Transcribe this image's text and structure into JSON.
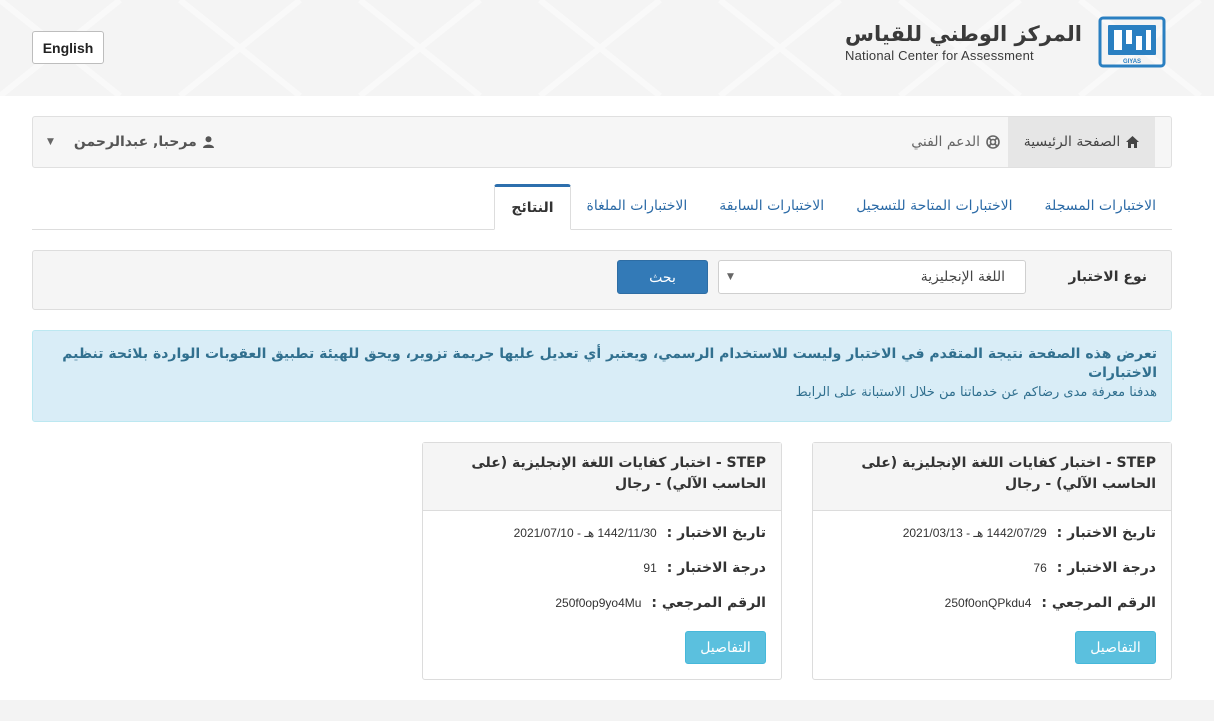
{
  "header": {
    "language_button": "English",
    "brand_ar": "المركز الوطني للقياس",
    "brand_en": "National Center for Assessment",
    "logo_text": "GIYAS"
  },
  "navbar": {
    "home": "الصفحة الرئيسية",
    "support": "الدعم الفني",
    "user": "مرحبا, عبدالرحمن"
  },
  "tabs": [
    {
      "label": "الاختبارات المسجلة",
      "active": false
    },
    {
      "label": "الاختبارات المتاحة للتسجيل",
      "active": false
    },
    {
      "label": "الاختبارات السابقة",
      "active": false
    },
    {
      "label": "الاختبارات الملغاة",
      "active": false
    },
    {
      "label": "النتائج",
      "active": true
    }
  ],
  "filter": {
    "label": "نوع الاختبار",
    "selected": "اللغة الإنجليزية",
    "search_button": "بحث"
  },
  "alert": {
    "message": "تعرض هذه الصفحة نتيجة المتقدم في الاختبار وليست للاستخدام الرسمي، ويعتبر أي تعديل عليها جريمة تزوير، ويحق للهيئة تطبيق العقوبات الواردة بلائحة تنظيم الاختبارات",
    "survey_link": "هدفنا معرفة مدى رضاكم عن خدماتنا من خلال الاستبانة على الرابط"
  },
  "results": [
    {
      "title": "STEP - اختبار كفايات اللغة الإنجليزية (على الحاسب الآلي) - رجال",
      "date_label": "تاريخ الاختبار :",
      "date_value": "1442/07/29 هـ - 2021/03/13",
      "grade_label": "درجة الاختبار :",
      "grade_value": "76",
      "ref_label": "الرقم المرجعي :",
      "ref_value": "250f0onQPkdu4",
      "details_button": "التفاصيل"
    },
    {
      "title": "STEP - اختبار كفايات اللغة الإنجليزية (على الحاسب الآلي) - رجال",
      "date_label": "تاريخ الاختبار :",
      "date_value": "1442/11/30 هـ - 2021/07/10",
      "grade_label": "درجة الاختبار :",
      "grade_value": "91",
      "ref_label": "الرقم المرجعي :",
      "ref_value": "250f0op9yo4Mu",
      "details_button": "التفاصيل"
    }
  ],
  "colors": {
    "primary": "#337ab7",
    "info_button": "#5bc0de",
    "alert_bg": "#d9edf7",
    "alert_text": "#31708f",
    "logo_blue": "#2a7fc1"
  },
  "icons": {
    "home": "home-icon",
    "support": "lifebuoy-icon",
    "user": "user-icon",
    "dropdown": "caret-down-icon"
  }
}
